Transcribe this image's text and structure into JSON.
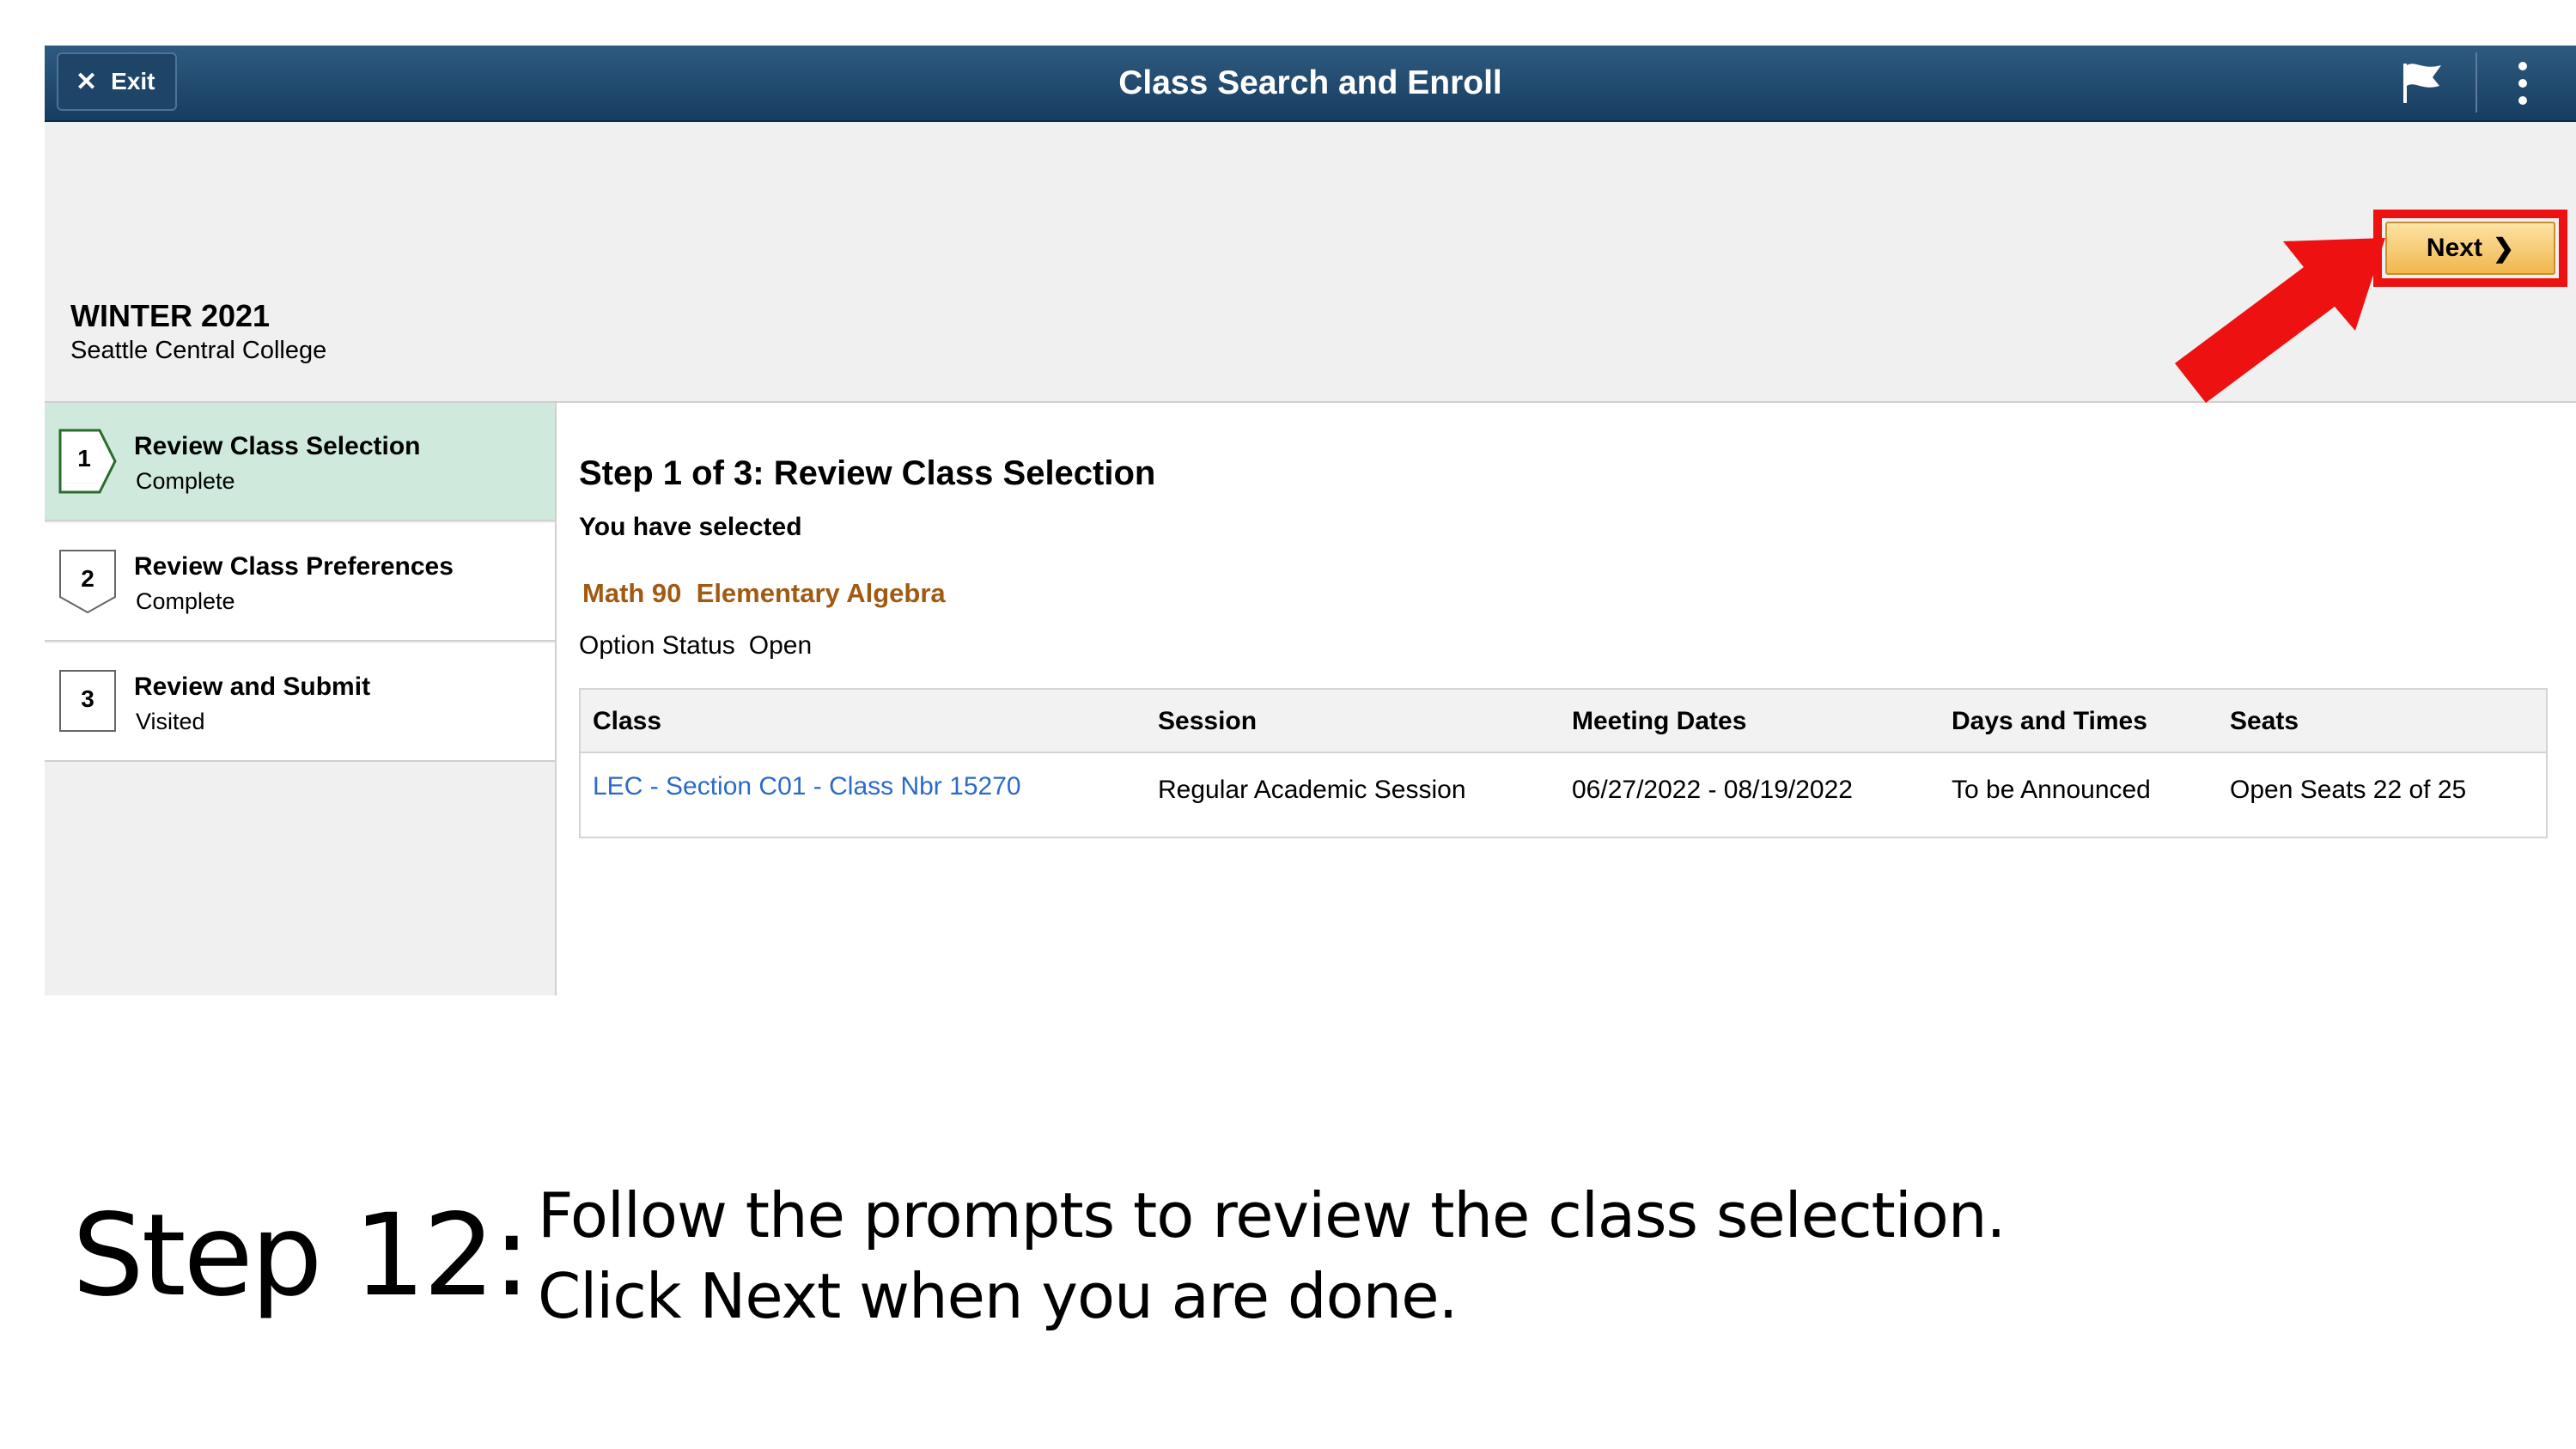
{
  "header": {
    "exit_label": "Exit",
    "title": "Class Search and Enroll",
    "icons": [
      "close-icon",
      "flag-icon",
      "more-vertical-icon"
    ]
  },
  "term": {
    "name": "WINTER 2021",
    "institution": "Seattle Central College"
  },
  "next_button": {
    "label": "Next"
  },
  "steps": [
    {
      "number": "1",
      "title": "Review Class Selection",
      "status": "Complete"
    },
    {
      "number": "2",
      "title": "Review Class Preferences",
      "status": "Complete"
    },
    {
      "number": "3",
      "title": "Review and Submit",
      "status": "Visited"
    }
  ],
  "main": {
    "heading": "Step 1 of 3: Review Class Selection",
    "selected_label": "You have selected",
    "course": "Math 90  Elementary Algebra",
    "option_status_label": "Option Status",
    "option_status_value": "Open",
    "table": {
      "columns": [
        "Class",
        "Session",
        "Meeting Dates",
        "Days and Times",
        "Seats"
      ],
      "rows": [
        {
          "class": "LEC - Section C01 - Class Nbr 15270",
          "session": "Regular Academic Session",
          "meeting_dates": "06/27/2022 - 08/19/2022",
          "days_times": "To be Announced",
          "seats": "Open Seats 22 of 25"
        }
      ]
    }
  },
  "caption": {
    "step": "Step 12:",
    "line1": "Follow the prompts to review the class selection.",
    "line2_prefix": "Click ",
    "line2_bold": "Next",
    "line2_suffix": " when you are done."
  },
  "colors": {
    "header_bar": "#1f4a70",
    "active_step": "#cfeadc",
    "course_title": "#a15a12",
    "link": "#2a6bc9",
    "next_button": "#f0b74e",
    "highlight": "#ee1111"
  }
}
